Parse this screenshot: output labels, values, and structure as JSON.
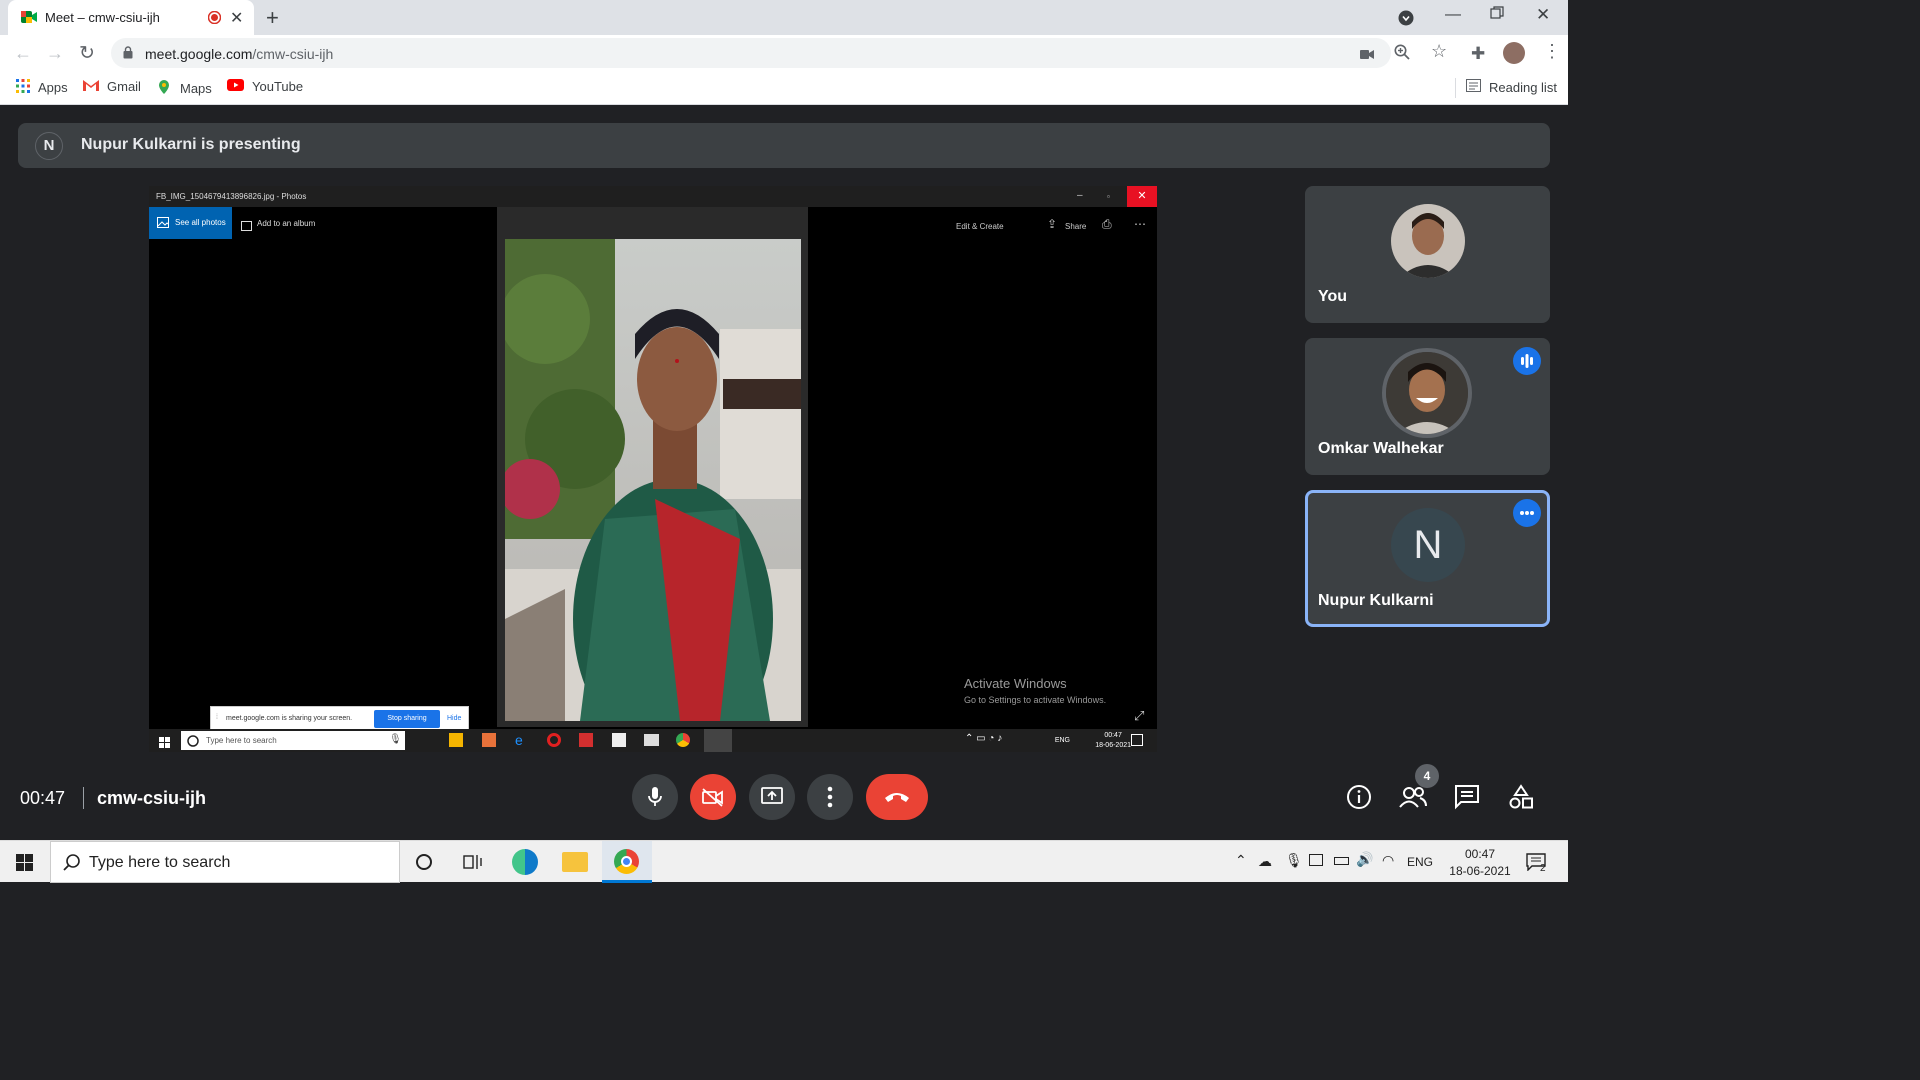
{
  "browser": {
    "tab_title": "Meet – cmw-csiu-ijh",
    "url_domain": "meet.google.com",
    "url_path": "/cmw-csiu-ijh",
    "bookmarks": [
      "Apps",
      "Gmail",
      "Maps",
      "YouTube"
    ],
    "reading_list": "Reading list"
  },
  "meet": {
    "banner_avatar": "N",
    "banner_text": "Nupur Kulkarni is presenting",
    "time": "00:47",
    "meeting_code": "cmw-csiu-ijh",
    "people_count": "4",
    "participants": [
      {
        "name": "You"
      },
      {
        "name": "Omkar Walhekar"
      },
      {
        "name": "Nupur Kulkarni",
        "initial": "N"
      }
    ]
  },
  "shared_screen": {
    "window_title": "FB_IMG_1504679413896826.jpg - Photos",
    "see_all": "See all photos",
    "add_album": "Add to an album",
    "edit_create": "Edit & Create",
    "share": "Share",
    "activate_title": "Activate Windows",
    "activate_sub": "Go to Settings to activate Windows.",
    "sharing_msg": "meet.google.com is sharing your screen.",
    "stop_sharing": "Stop sharing",
    "hide": "Hide",
    "search_placeholder": "Type here to search",
    "lang": "ENG",
    "clock_time": "00:47",
    "clock_date": "18-06-2021"
  },
  "taskbar": {
    "search_placeholder": "Type here to search",
    "lang": "ENG",
    "clock_time": "00:47",
    "clock_date": "18-06-2021",
    "notifications": "2"
  },
  "colors": {
    "meet_bg": "#202124",
    "tile_bg": "#3c4043",
    "end_call": "#ea4335",
    "accent": "#1a73e8"
  }
}
